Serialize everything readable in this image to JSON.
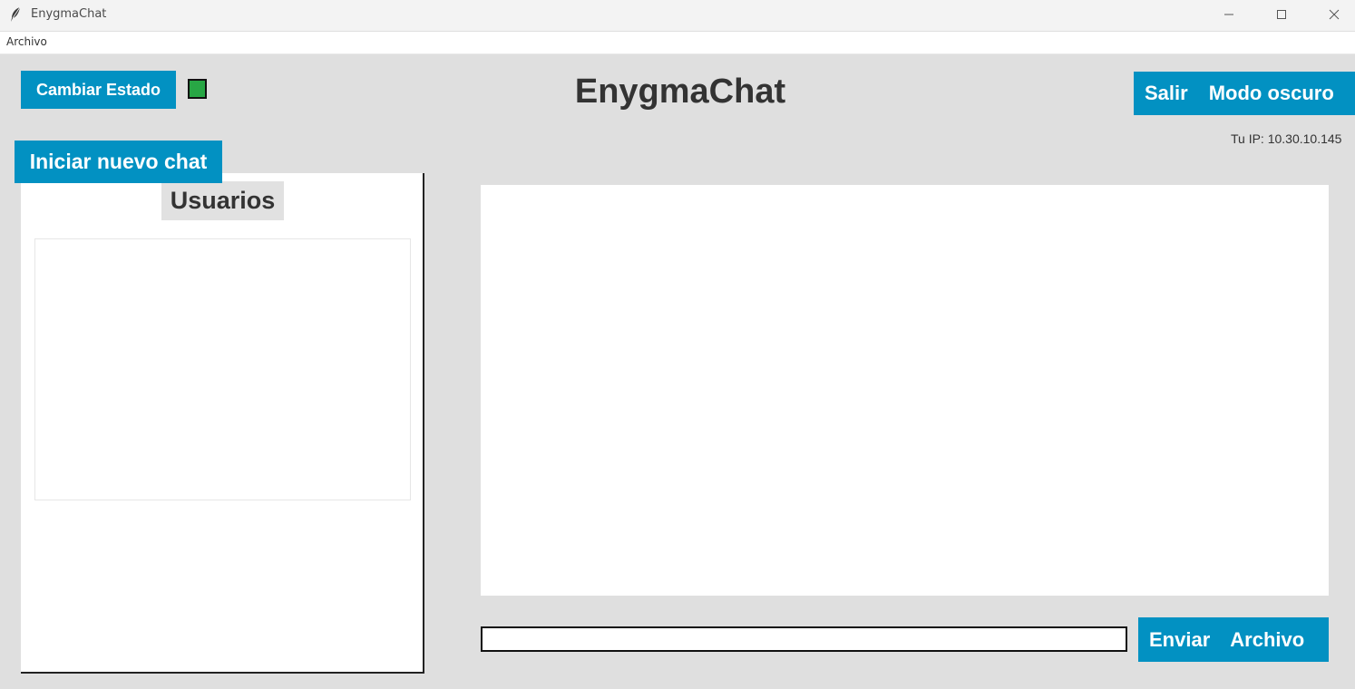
{
  "window": {
    "title": "EnygmaChat",
    "icon": "feather-icon"
  },
  "menubar": {
    "items": [
      "Archivo"
    ]
  },
  "header": {
    "change_status_label": "Cambiar Estado",
    "status_color": "#28a745",
    "app_title": "EnygmaChat",
    "exit_label": "Salir",
    "dark_mode_label": "Modo oscuro",
    "ip_text": "Tu IP: 10.30.10.145"
  },
  "sidebar": {
    "new_chat_label": "Iniciar nuevo chat",
    "users_title": "Usuarios",
    "users": []
  },
  "chat": {
    "messages": [],
    "input_value": "",
    "send_label": "Enviar",
    "file_label": "Archivo"
  },
  "colors": {
    "accent": "#0291c2",
    "background": "#dfdfdf"
  }
}
